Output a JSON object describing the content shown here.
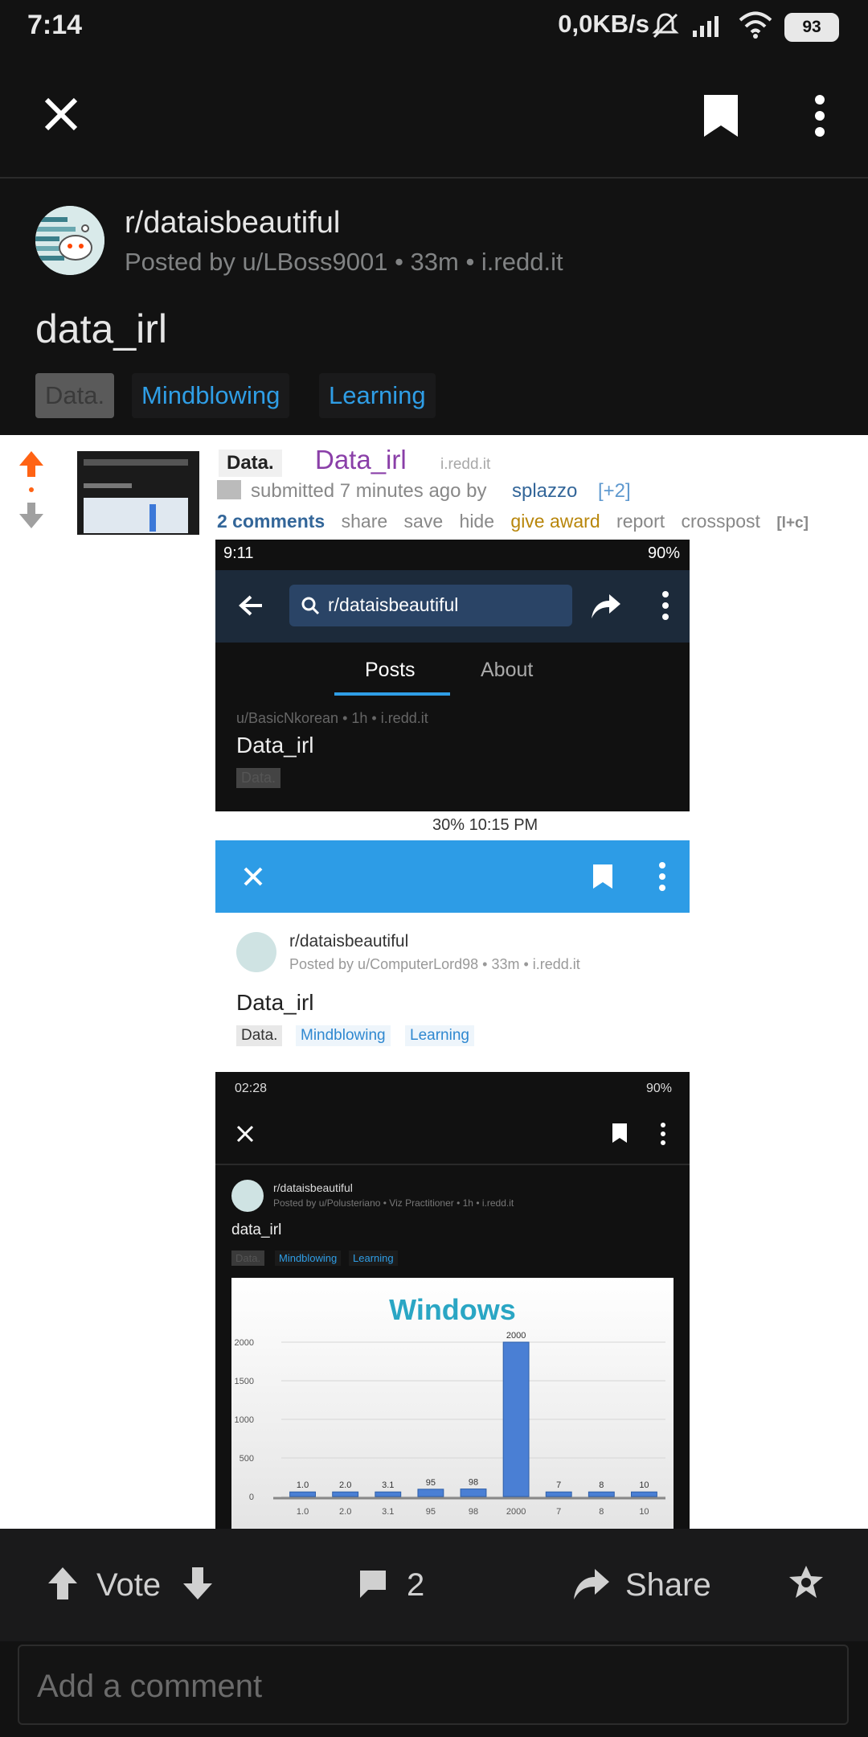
{
  "status_bar": {
    "time": "7:14",
    "net_speed": "0,0KB/s",
    "battery": "93"
  },
  "toolbar": {
    "close_icon": "close-icon",
    "bookmark_icon": "bookmark-icon",
    "more_icon": "more-vertical-icon"
  },
  "post": {
    "subreddit": "r/dataisbeautiful",
    "meta": "Posted by u/LBoss9001 • 33m • i.redd.it",
    "title": "data_irl",
    "flairs": [
      "Data.",
      "Mindblowing",
      "Learning"
    ]
  },
  "image": {
    "oldreddit": {
      "flair": "Data.",
      "title": "Data_irl",
      "domain": "i.redd.it",
      "submitted_pre": "submitted 7 minutes ago by ",
      "submitted_user": "splazzo",
      "tag": "[+2]",
      "links": [
        "2 comments",
        "share",
        "save",
        "hide",
        "give award",
        "report",
        "crosspost",
        "[l+c]"
      ]
    },
    "shot1": {
      "time": "9:11",
      "battery": "90%",
      "search": "r/dataisbeautiful",
      "tabs": [
        "Posts",
        "About"
      ],
      "meta": "u/BasicNkorean • 1h • i.redd.it",
      "title": "Data_irl",
      "flair": "Data."
    },
    "shot2": {
      "status": "30%  10:15 PM",
      "subreddit": "r/dataisbeautiful",
      "meta": "Posted by u/ComputerLord98 • 33m • i.redd.it",
      "title": "Data_irl",
      "flairs": [
        "Data.",
        "Mindblowing",
        "Learning"
      ]
    },
    "shot3": {
      "time": "02:28",
      "battery": "90%",
      "subreddit": "r/dataisbeautiful",
      "meta": "Posted by u/Polusteriano  • Viz Practitioner • 1h • i.redd.it",
      "title": "data_irl",
      "flairs": [
        "Data.",
        "Mindblowing",
        "Learning"
      ]
    },
    "chart_data": {
      "type": "bar",
      "title": "Windows",
      "categories": [
        "1.0",
        "2.0",
        "3.1",
        "95",
        "98",
        "2000",
        "7",
        "8",
        "10"
      ],
      "values": [
        1.0,
        2.0,
        3.1,
        95,
        98,
        2000,
        7,
        8,
        10
      ],
      "data_labels": [
        "1.0",
        "2.0",
        "3.1",
        "95",
        "98",
        "2000",
        "7",
        "8",
        "10"
      ],
      "yticks": [
        "2000",
        "1500",
        "1000",
        "500",
        "0"
      ],
      "ylim": [
        0,
        2000
      ],
      "grid": true
    }
  },
  "bottom": {
    "vote_label": "Vote",
    "comments_count": "2",
    "share_label": "Share",
    "comment_placeholder": "Add a comment"
  }
}
